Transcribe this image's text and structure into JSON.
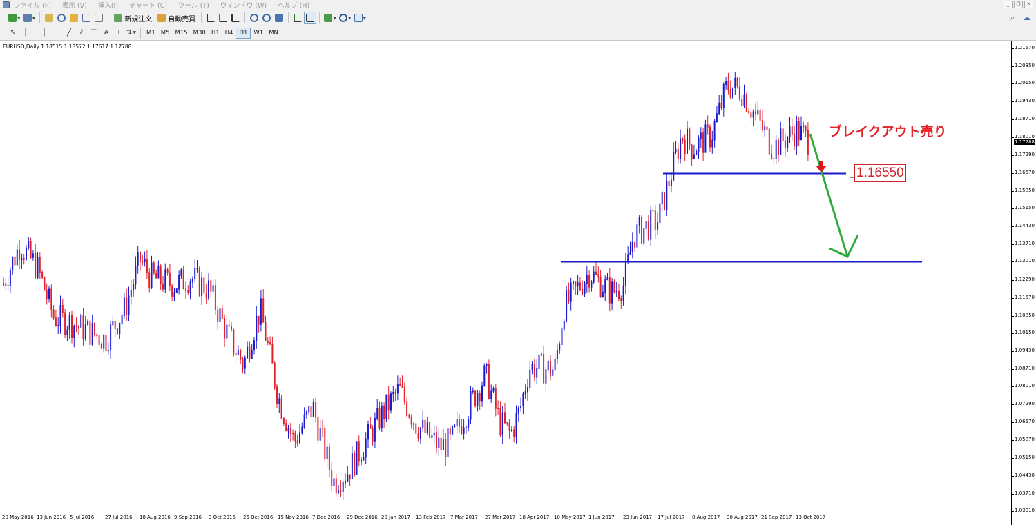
{
  "menu": {
    "items": [
      "ファイル (F)",
      "表示 (V)",
      "挿入(I)",
      "チャート (C)",
      "ツール (T)",
      "ウィンドウ (W)",
      "ヘルプ (H)"
    ]
  },
  "toolbar": {
    "new_order_label": "新規注文",
    "auto_trade_label": "自動売買",
    "timeframes": [
      "M1",
      "M5",
      "M15",
      "M30",
      "H1",
      "H4",
      "D1",
      "W1",
      "MN"
    ],
    "active_timeframe": "D1"
  },
  "chart": {
    "title": "EURUSD,Daily  1.18515 1.18572 1.17617 1.17788",
    "current_price": "1.17788",
    "annotation": "ブレイクアウト売り",
    "level_label": "1.16550",
    "price_labels": [
      "1.21570",
      "1.20850",
      "1.20150",
      "1.19430",
      "1.18710",
      "1.18010",
      "1.17290",
      "1.16570",
      "1.15850",
      "1.15150",
      "1.14430",
      "1.13710",
      "1.13010",
      "1.12290",
      "1.11570",
      "1.10850",
      "1.10150",
      "1.09430",
      "1.08710",
      "1.08010",
      "1.07290",
      "1.06570",
      "1.05870",
      "1.05150",
      "1.04430",
      "1.03710",
      "1.03010"
    ],
    "date_labels": [
      "20 May 2016",
      "13 Jun 2016",
      "5 Jul 2016",
      "27 Jul 2016",
      "18 Aug 2016",
      "9 Sep 2016",
      "3 Oct 2016",
      "25 Oct 2016",
      "15 Nov 2016",
      "7 Dec 2016",
      "29 Dec 2016",
      "20 Jan 2017",
      "13 Feb 2017",
      "7 Mar 2017",
      "27 Mar 2017",
      "18 Apr 2017",
      "10 May 2017",
      "1 Jun 2017",
      "23 Jun 2017",
      "17 Jul 2017",
      "8 Aug 2017",
      "30 Aug 2017",
      "21 Sep 2017",
      "13 Oct 2017"
    ],
    "colors": {
      "up": "#1a1ad0",
      "down": "#e0202a",
      "level": "#1a1acc",
      "arrow": "#2eaa3a"
    }
  },
  "chart_data": {
    "type": "candlestick",
    "symbol": "EURUSD",
    "timeframe": "Daily",
    "ylim": [
      1.0301,
      1.2157
    ],
    "path": [
      [
        "20 May 2016",
        1.121
      ],
      [
        "1 Jun 2016",
        1.137
      ],
      [
        "13 Jun 2016",
        1.128
      ],
      [
        "24 Jun 2016",
        1.108
      ],
      [
        "5 Jul 2016",
        1.106
      ],
      [
        "27 Jul 2016",
        1.099
      ],
      [
        "8 Aug 2016",
        1.111
      ],
      [
        "18 Aug 2016",
        1.131
      ],
      [
        "25 Aug 2016",
        1.124
      ],
      [
        "9 Sep 2016",
        1.121
      ],
      [
        "20 Sep 2016",
        1.124
      ],
      [
        "3 Oct 2016",
        1.119
      ],
      [
        "14 Oct 2016",
        1.102
      ],
      [
        "25 Oct 2016",
        1.089
      ],
      [
        "30 Oct 2016",
        1.101
      ],
      [
        "4 Nov 2016",
        1.111
      ],
      [
        "15 Nov 2016",
        1.076
      ],
      [
        "25 Nov 2016",
        1.058
      ],
      [
        "7 Dec 2016",
        1.072
      ],
      [
        "20 Dec 2016",
        1.042
      ],
      [
        "29 Dec 2016",
        1.046
      ],
      [
        "20 Jan 2017",
        1.069
      ],
      [
        "1 Feb 2017",
        1.079
      ],
      [
        "13 Feb 2017",
        1.065
      ],
      [
        "28 Feb 2017",
        1.056
      ],
      [
        "7 Mar 2017",
        1.058
      ],
      [
        "27 Mar 2017",
        1.085
      ],
      [
        "5 Apr 2017",
        1.066
      ],
      [
        "12 Apr 2017",
        1.061
      ],
      [
        "18 Apr 2017",
        1.071
      ],
      [
        "24 Apr 2017",
        1.088
      ],
      [
        "10 May 2017",
        1.087
      ],
      [
        "16 May 2017",
        1.112
      ],
      [
        "1 Jun 2017",
        1.126
      ],
      [
        "15 Jun 2017",
        1.118
      ],
      [
        "23 Jun 2017",
        1.121
      ],
      [
        "30 Jun 2017",
        1.141
      ],
      [
        "17 Jul 2017",
        1.147
      ],
      [
        "1 Aug 2017",
        1.181
      ],
      [
        "8 Aug 2017",
        1.176
      ],
      [
        "20 Aug 2017",
        1.181
      ],
      [
        "30 Aug 2017",
        1.201
      ],
      [
        "8 Sep 2017",
        1.199
      ],
      [
        "21 Sep 2017",
        1.184
      ],
      [
        "28 Sep 2017",
        1.176
      ],
      [
        "13 Oct 2017",
        1.183
      ],
      [
        "23 Oct 2017",
        1.1779
      ]
    ],
    "lines": [
      {
        "name": "breakout-level",
        "price": 1.1655
      },
      {
        "name": "target-level",
        "price": 1.1301
      }
    ]
  }
}
